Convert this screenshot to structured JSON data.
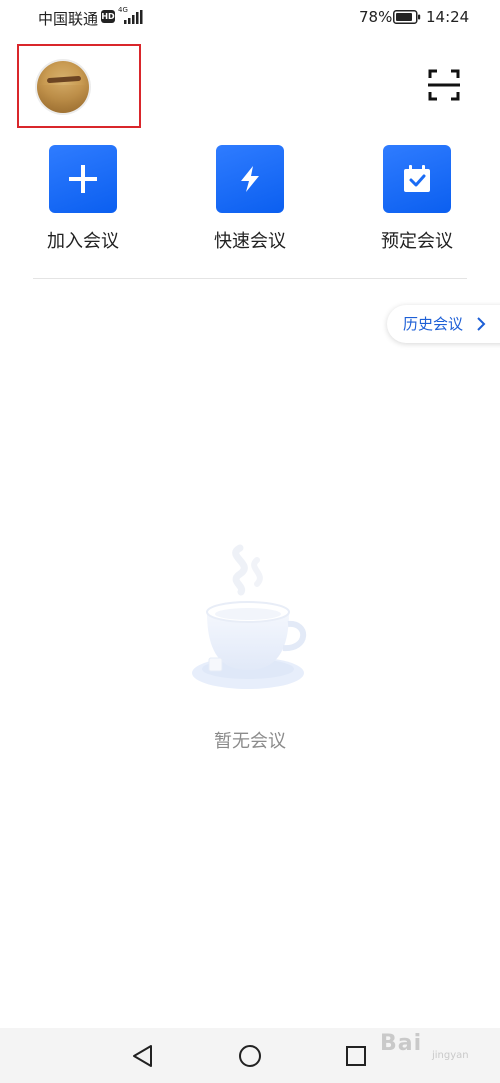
{
  "status_bar": {
    "carrier": "中国联通",
    "hd": "HD",
    "network": "4G",
    "battery": "78%",
    "time": "14:24"
  },
  "header": {
    "avatar_icon": "user-avatar",
    "scan_icon": "scan-icon"
  },
  "actions": [
    {
      "label": "加入会议",
      "icon": "plus-icon"
    },
    {
      "label": "快速会议",
      "icon": "lightning-icon"
    },
    {
      "label": "预定会议",
      "icon": "calendar-check-icon"
    }
  ],
  "history": {
    "label": "历史会议"
  },
  "empty_state": {
    "text": "暂无会议",
    "icon": "coffee-cup-icon"
  },
  "watermark": {
    "text": "Bai",
    "sub": "jingyan"
  },
  "colors": {
    "accent": "#0b5ff0",
    "highlight": "#d9262b",
    "link": "#1d5fd6"
  }
}
